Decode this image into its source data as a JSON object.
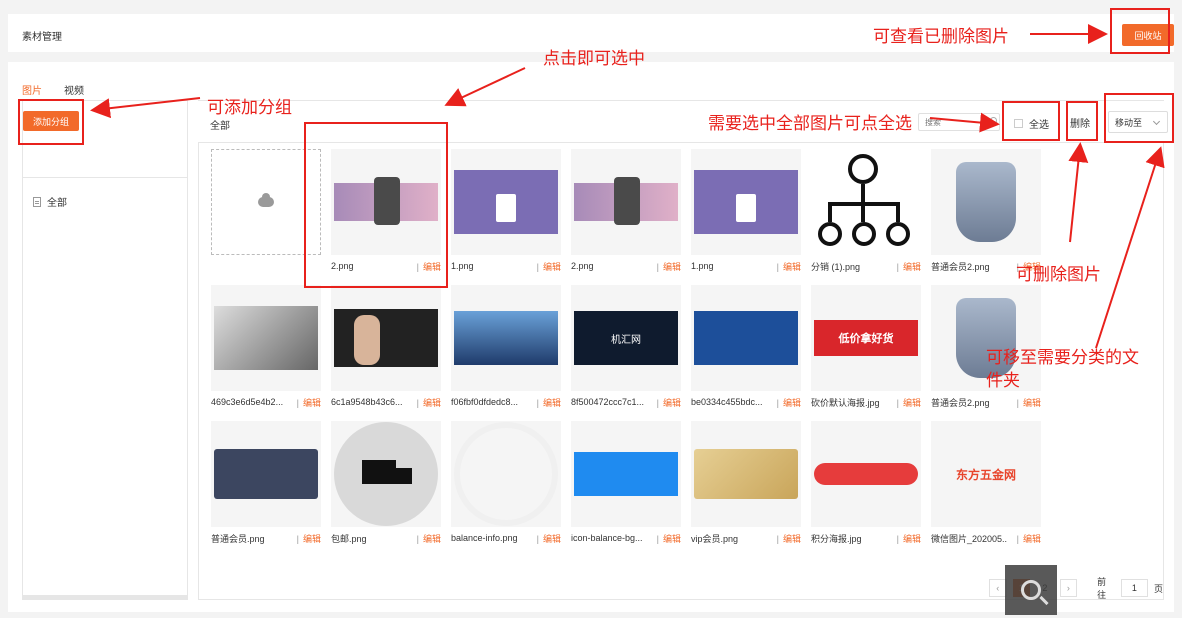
{
  "header": {
    "title": "素材管理",
    "recycle_label": "回收站"
  },
  "tabs": [
    {
      "label": "图片",
      "active": true
    },
    {
      "label": "视频",
      "active": false
    }
  ],
  "sidebar": {
    "add_group_label": "添加分组",
    "groups": [
      {
        "label": "全部"
      }
    ]
  },
  "toolbar": {
    "breadcrumb": "全部",
    "search_placeholder": "搜索",
    "select_all_label": "全选",
    "delete_label": "删除",
    "move_label": "移动至"
  },
  "edit_label": "编辑",
  "images": [
    {
      "name": "2.png",
      "icon": "phone-promo-image"
    },
    {
      "name": "1.png",
      "icon": "purple-card-image"
    },
    {
      "name": "2.png",
      "icon": "phone-promo-image"
    },
    {
      "name": "1.png",
      "icon": "purple-card-image"
    },
    {
      "name": "分销 (1).png",
      "icon": "distribution-tree-image"
    },
    {
      "name": "普通会员2.png",
      "icon": "medal-image"
    },
    {
      "name": "469c3e6d5e4b2...",
      "icon": "laptop-image"
    },
    {
      "name": "6c1a9548b43c6...",
      "icon": "speaker-image"
    },
    {
      "name": "f06fbf0dfdedc8...",
      "icon": "conference-image"
    },
    {
      "name": "8f500472ccc7c1...",
      "icon": "brand-banner-image"
    },
    {
      "name": "be0334c455bdc...",
      "icon": "stage-image"
    },
    {
      "name": "砍价默认海报.jpg",
      "icon": "bargain-poster-image"
    },
    {
      "name": "普通会员2.png",
      "icon": "medal-image"
    },
    {
      "name": "普通会员.png",
      "icon": "member-card-image"
    },
    {
      "name": "包邮.png",
      "icon": "truck-icon"
    },
    {
      "name": "balance-info.png",
      "icon": "balance-image"
    },
    {
      "name": "icon-balance-bg...",
      "icon": "blue-banner-image"
    },
    {
      "name": "vip会员.png",
      "icon": "vip-card-image"
    },
    {
      "name": "积分海报.jpg",
      "icon": "points-poster-image"
    },
    {
      "name": "微信图片_202005...",
      "icon": "logo-image"
    }
  ],
  "thumb_text": {
    "brand": "机汇网",
    "bargain": "低价拿好货",
    "logo": "东方五金网"
  },
  "pagination": {
    "pages": [
      "1",
      "2"
    ],
    "current": "1",
    "goto_label": "前往",
    "goto_value": "1",
    "page_unit": "页"
  },
  "annotations": {
    "recycle_note": "可查看已删除图片",
    "click_note": "点击即可选中",
    "add_group_note": "可添加分组",
    "select_all_note": "需要选中全部图片可点全选",
    "delete_note": "可删除图片",
    "move_note_line1": "可移至需要分类的文",
    "move_note_line2": "件夹"
  },
  "colors": {
    "accent": "#f26a2a",
    "annotation": "#e8211c"
  }
}
